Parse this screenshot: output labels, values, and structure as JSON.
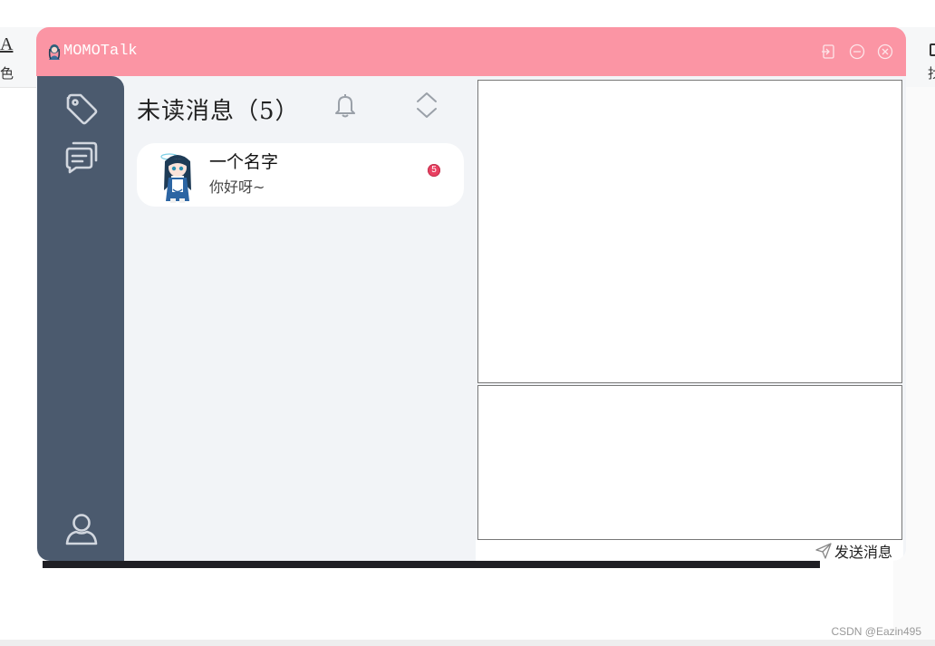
{
  "app": {
    "title": "MOMOTalk",
    "accent_color": "#fb95a4",
    "sidebar_color": "#4b5a6e"
  },
  "titlebar_buttons": [
    {
      "name": "pin",
      "icon": "pin-icon"
    },
    {
      "name": "minimize",
      "icon": "minimize-icon"
    },
    {
      "name": "close",
      "icon": "close-icon"
    }
  ],
  "sidebar": {
    "items": [
      {
        "name": "tags",
        "icon": "tag-icon"
      },
      {
        "name": "messages",
        "icon": "chat-icon"
      },
      {
        "name": "profile",
        "icon": "user-icon"
      }
    ]
  },
  "list": {
    "title": "未读消息（5）",
    "bell_icon": "bell-icon",
    "sort_icon": "sort-icon",
    "contacts": [
      {
        "name": "一个名字",
        "message": "你好呀~",
        "unread": "5"
      }
    ]
  },
  "chat": {
    "send_label": "发送消息",
    "send_icon": "send-icon"
  },
  "background": {
    "left_char_a": "A",
    "left_char_b": "色",
    "right_char_b": "找"
  },
  "watermark": "CSDN @Eazin495"
}
